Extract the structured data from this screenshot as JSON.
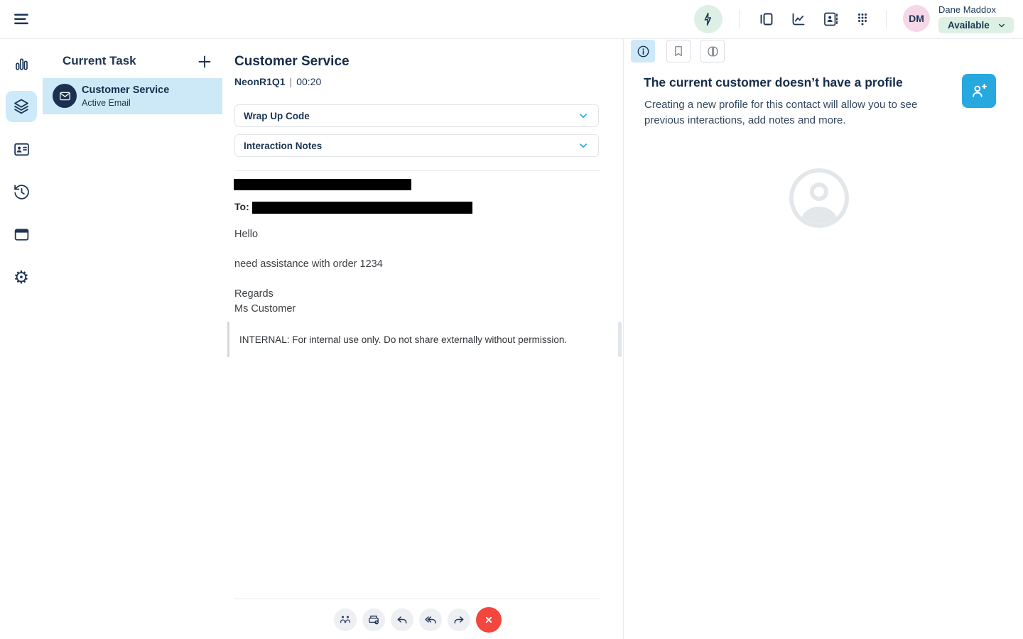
{
  "topbar": {
    "user": {
      "name": "Dane Maddox",
      "initials": "DM",
      "status": "Available"
    }
  },
  "task_panel": {
    "title": "Current Task",
    "tasks": [
      {
        "title": "Customer Service",
        "subtitle": "Active Email"
      }
    ]
  },
  "interaction": {
    "title": "Customer Service",
    "queue": "NeonR1Q1",
    "separator": "|",
    "timer": "00:20",
    "sections": [
      {
        "label": "Wrap Up Code"
      },
      {
        "label": "Interaction Notes"
      }
    ],
    "email": {
      "to_label": "To:",
      "greeting": "Hello",
      "body": "need assistance with order 1234",
      "signoff": "Regards",
      "sender": "Ms Customer",
      "internal_note": "INTERNAL: For internal use only. Do not share externally without permission."
    }
  },
  "profile_panel": {
    "heading": "The current customer doesn’t have a profile",
    "description": "Creating a new profile for this contact will allow you to see previous interactions, add notes and more."
  },
  "colors": {
    "navy": "#1c3553",
    "accent_blue": "#27a9e0",
    "light_blue_highlight": "#cde9f8",
    "chevron_cyan": "#2fa7dd",
    "status_green_bg": "#ddf0e4",
    "lightning_green_bg": "#def0e6",
    "avatar_pink": "#f5d7e8",
    "disconnect_red": "#f3463e",
    "redaction_black": "#000000"
  }
}
